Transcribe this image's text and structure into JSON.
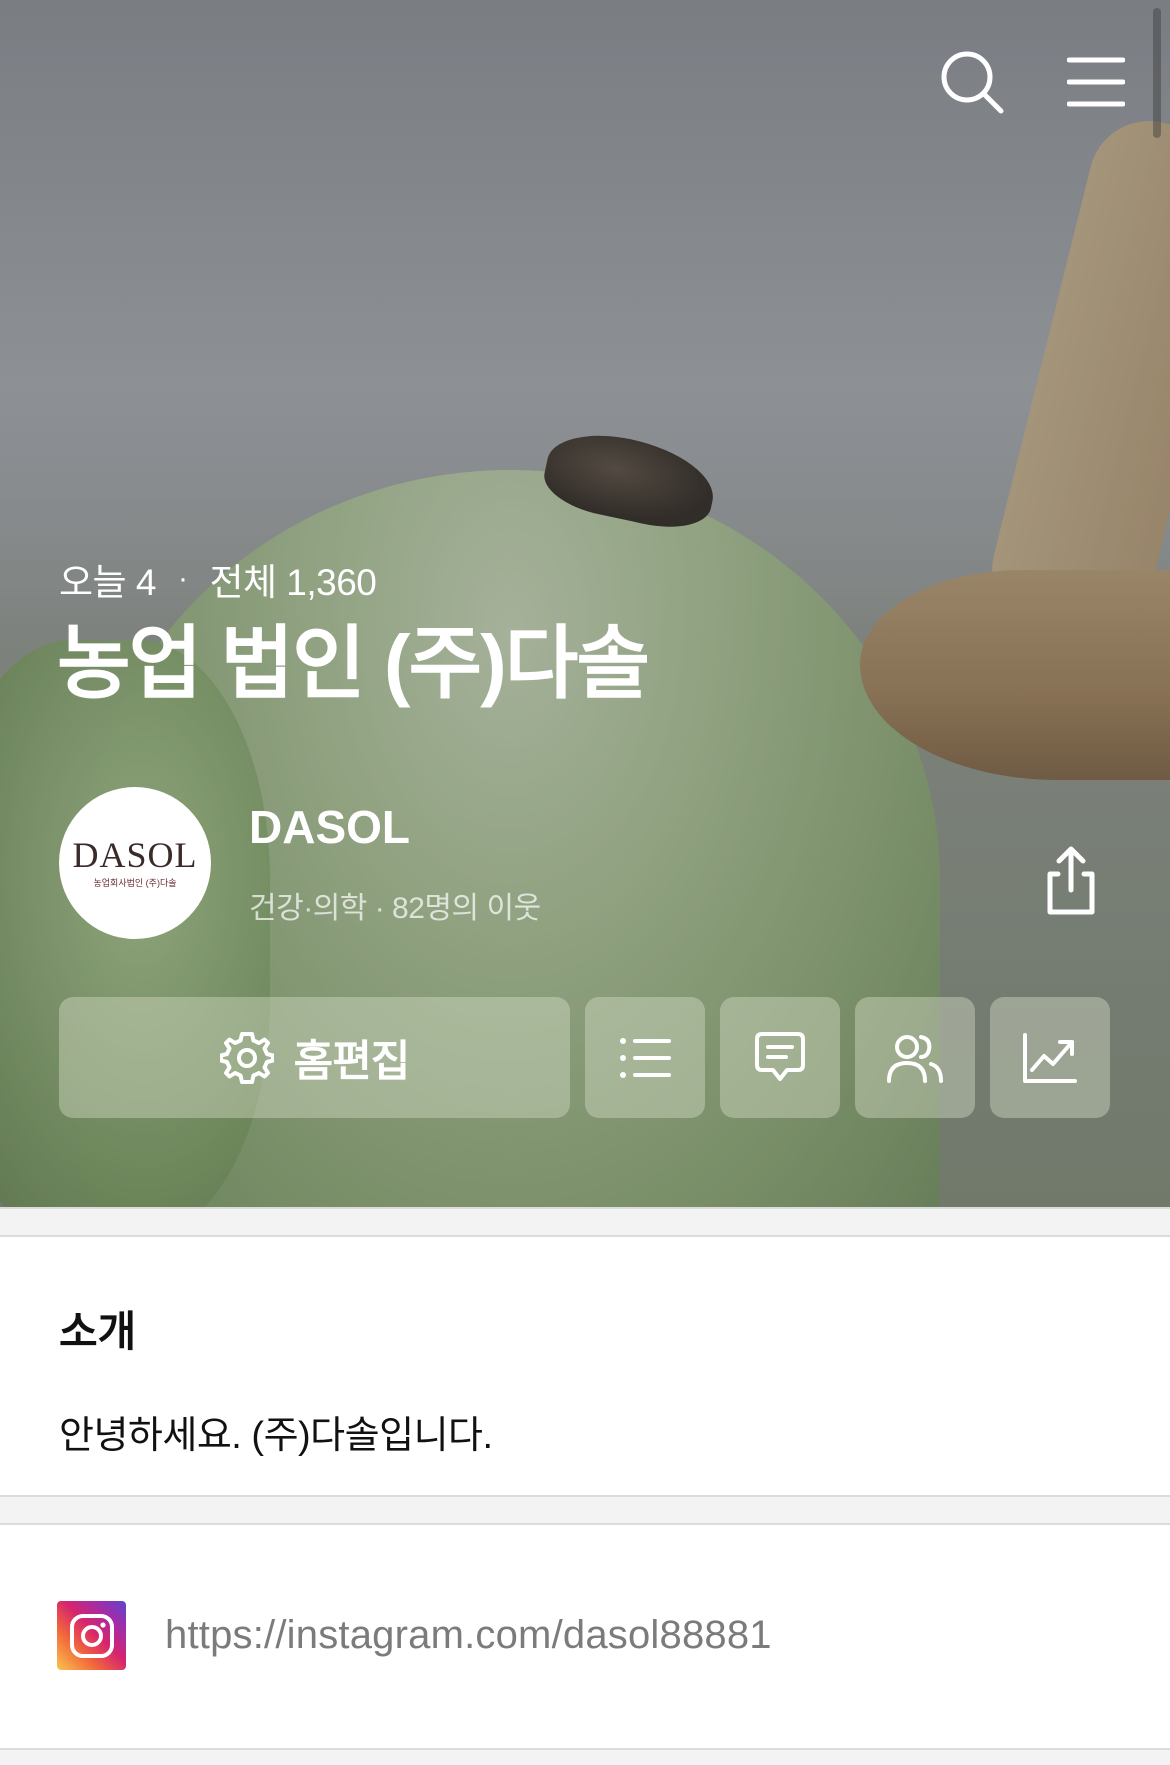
{
  "header": {
    "icons": {
      "search": "search-icon",
      "menu": "hamburger-menu-icon"
    }
  },
  "blog": {
    "visits": {
      "today": "오늘 4",
      "separator": "·",
      "total": "전체 1,360"
    },
    "title": "농업 법인 (주)다솔",
    "avatar": {
      "logo_main": "DASOL",
      "logo_sub": "농업회사법인 (주)다솔"
    },
    "nickname": "DASOL",
    "meta": "건강·의학 · 82명의 이웃"
  },
  "actions": {
    "edit_label": "홈편집",
    "icons": [
      "gear-icon",
      "list-icon",
      "comment-icon",
      "neighbors-icon",
      "stats-icon"
    ],
    "share_icon": "share-icon"
  },
  "intro": {
    "title": "소개",
    "text": "안녕하세요. (주)다솔입니다."
  },
  "links": {
    "instagram_url": "https://instagram.com/dasol88881",
    "icon": "instagram-icon"
  },
  "colors": {
    "overlay_button": "#d6dec8",
    "separator": "#f3f3f3",
    "link_text": "#7b7b7b"
  }
}
